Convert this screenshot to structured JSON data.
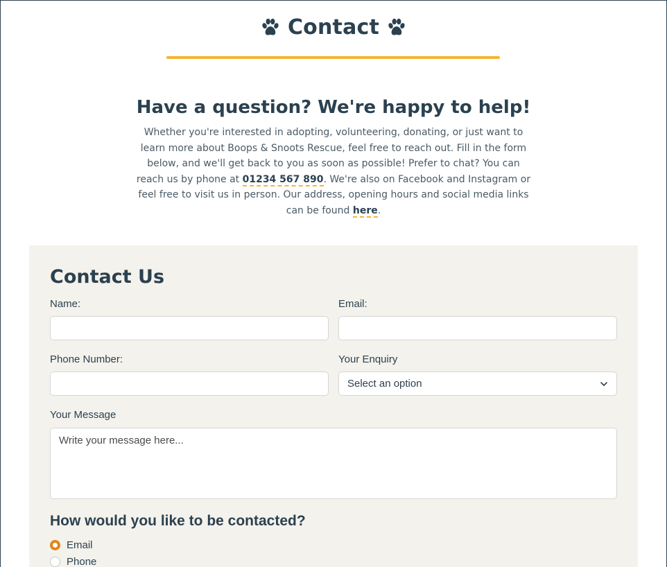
{
  "header": {
    "title": "Contact"
  },
  "intro": {
    "heading": "Have a question? We're happy to help!",
    "text_before_phone": "Whether you're interested in adopting, volunteering, donating, or just want to learn more about Boops & Snoots Rescue, feel free to reach out. Fill in the form below, and we'll get back to you as soon as possible! Prefer to chat? You can reach us by phone at ",
    "phone_link": "01234 567 890",
    "text_after_phone": ". We're also on Facebook and Instagram or feel free to visit us in person. Our address, opening hours and social media links can be found ",
    "here_link": "here",
    "text_end": "."
  },
  "form": {
    "title": "Contact Us",
    "name_label": "Name:",
    "email_label": "Email:",
    "phone_label": "Phone Number:",
    "enquiry_label": "Your Enquiry",
    "enquiry_selected": "Select an option",
    "message_label": "Your Message",
    "message_placeholder": "Write your message here...",
    "contact_question": "How would you like to be contacted?",
    "contact_options": [
      {
        "label": "Email",
        "checked": true
      },
      {
        "label": "Phone",
        "checked": false
      }
    ]
  },
  "colors": {
    "accent": "#f9b233",
    "radio_accent": "#e3861b",
    "heading": "#2b4150",
    "panel_bg": "#f4f2ec"
  },
  "icons": [
    "paw-icon",
    "chevron-down-icon"
  ]
}
